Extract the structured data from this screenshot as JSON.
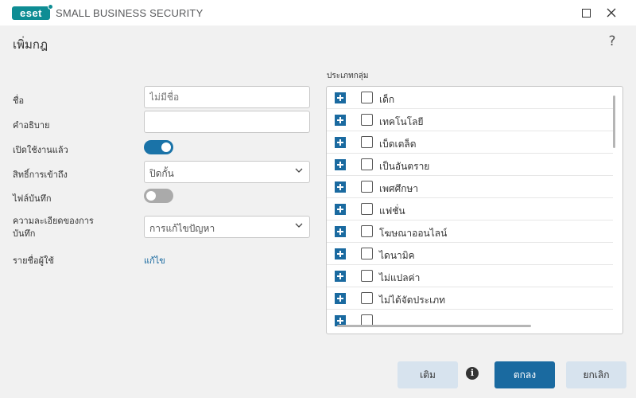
{
  "window": {
    "logo_text": "eset",
    "app_title": "SMALL BUSINESS SECURITY",
    "maximize_icon": "maximize-icon",
    "close_icon": "close-icon"
  },
  "header": {
    "title": "เพิ่มกฎ",
    "help": "?"
  },
  "form": {
    "name_label": "ชื่อ",
    "name_placeholder": "ไม่มีชื่อ",
    "description_label": "คำอธิบาย",
    "description_value": "",
    "enabled_label": "เปิดใช้งานแล้ว",
    "enabled": true,
    "access_label": "สิทธิ์การเข้าถึง",
    "access_value": "ปิดกั้น",
    "logging_label": "ไฟล์บันทึก",
    "logging": false,
    "verbosity_label": "ความละเอียดของการ บันทึก",
    "verbosity_value": "การแก้ไขปัญหา",
    "users_label": "รายชื่อผู้ใช้",
    "users_link": "แก้ไข"
  },
  "categories": {
    "label": "ประเภทกลุ่ม",
    "items": [
      {
        "label": "เด็ก",
        "checked": false
      },
      {
        "label": "เทคโนโลยี",
        "checked": false
      },
      {
        "label": "เบ็ดเตล็ด",
        "checked": false
      },
      {
        "label": "เป็นอันตราย",
        "checked": false
      },
      {
        "label": "เพศศึกษา",
        "checked": false
      },
      {
        "label": "แฟชั่น",
        "checked": false
      },
      {
        "label": "โฆษณาออนไลน์",
        "checked": false
      },
      {
        "label": "ไดนามิค",
        "checked": false
      },
      {
        "label": "ไม่แปลค่า",
        "checked": false
      },
      {
        "label": "ไม่ได้จัดประเภท",
        "checked": false
      },
      {
        "label": "",
        "checked": false
      }
    ]
  },
  "footer": {
    "add_label": "เติม",
    "info_glyph": "i",
    "ok_label": "ตกลง",
    "cancel_label": "ยกเลิก"
  },
  "colors": {
    "accent": "#1a6aa0",
    "brand": "#0e8d94",
    "secondary_button": "#d7e3ee"
  }
}
